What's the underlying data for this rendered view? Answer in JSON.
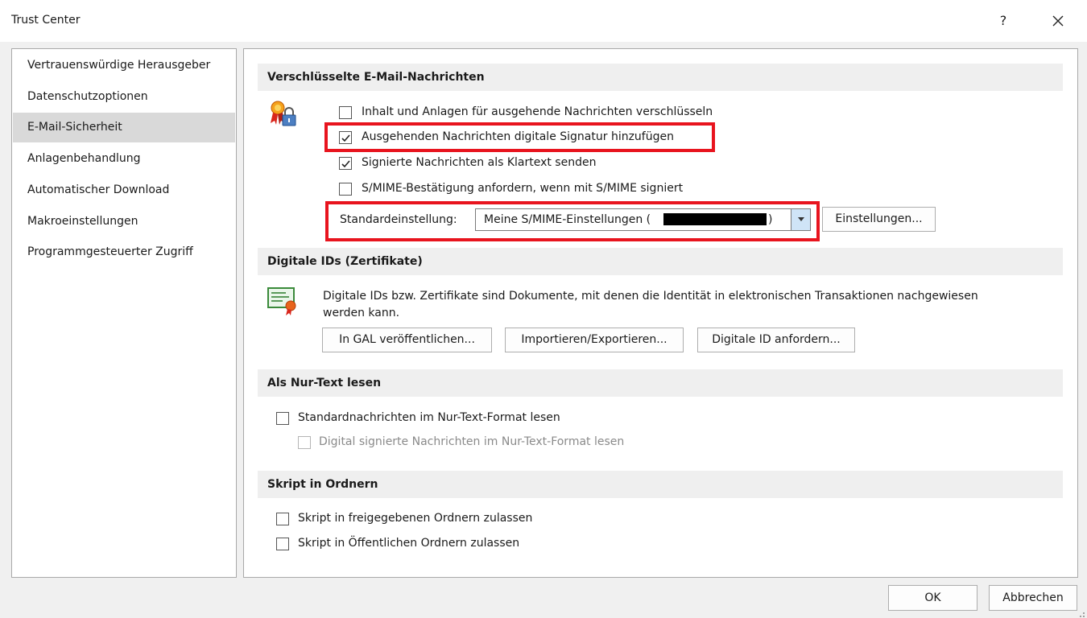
{
  "window": {
    "title": "Trust Center",
    "help_label": "?"
  },
  "sidebar": {
    "items": [
      {
        "label": "Vertrauenswürdige Herausgeber"
      },
      {
        "label": "Datenschutzoptionen"
      },
      {
        "label": "E-Mail-Sicherheit",
        "selected": true
      },
      {
        "label": "Anlagenbehandlung"
      },
      {
        "label": "Automatischer Download"
      },
      {
        "label": "Makroeinstellungen"
      },
      {
        "label": "Programmgesteuerter Zugriff"
      }
    ]
  },
  "encrypted": {
    "header": "Verschlüsselte E-Mail-Nachrichten",
    "icon": "certificate-lock-icon",
    "options": [
      {
        "label": "Inhalt und Anlagen für ausgehende Nachrichten verschlüsseln",
        "checked": false
      },
      {
        "label": "Ausgehenden Nachrichten digitale Signatur hinzufügen",
        "checked": true
      },
      {
        "label": "Signierte Nachrichten als Klartext senden",
        "checked": true
      },
      {
        "label": "S/MIME-Bestätigung anfordern, wenn mit S/MIME signiert",
        "checked": false
      }
    ],
    "default_label": "Standardeinstellung:",
    "default_value": "Meine S/MIME-Einstellungen (",
    "default_value_tail": ")",
    "settings_button": "Einstellungen..."
  },
  "digital_ids": {
    "header": "Digitale IDs (Zertifikate)",
    "icon": "certificate-icon",
    "description_line1": "Digitale IDs bzw. Zertifikate sind Dokumente, mit denen die Identität in elektronischen Transaktionen nachgewiesen",
    "description_line2": "werden kann.",
    "buttons": {
      "publish": "In GAL veröffentlichen...",
      "import_export": "Importieren/Exportieren...",
      "request": "Digitale ID anfordern..."
    }
  },
  "plain_text": {
    "header": "Als Nur-Text lesen",
    "options": [
      {
        "label": "Standardnachrichten im Nur-Text-Format lesen",
        "checked": false,
        "disabled": false
      },
      {
        "label": "Digital signierte Nachrichten im Nur-Text-Format lesen",
        "checked": false,
        "disabled": true
      }
    ]
  },
  "scripts": {
    "header": "Skript in Ordnern",
    "options": [
      {
        "label": "Skript in freigegebenen Ordnern zulassen",
        "checked": false
      },
      {
        "label": "Skript in Öffentlichen Ordnern zulassen",
        "checked": false
      }
    ]
  },
  "footer": {
    "ok": "OK",
    "cancel": "Abbrechen"
  },
  "colors": {
    "highlight_red": "#e8141e",
    "selected_bg": "#d9d9d9",
    "section_bg": "#efefef",
    "dialog_bg": "#f0f0f0"
  }
}
